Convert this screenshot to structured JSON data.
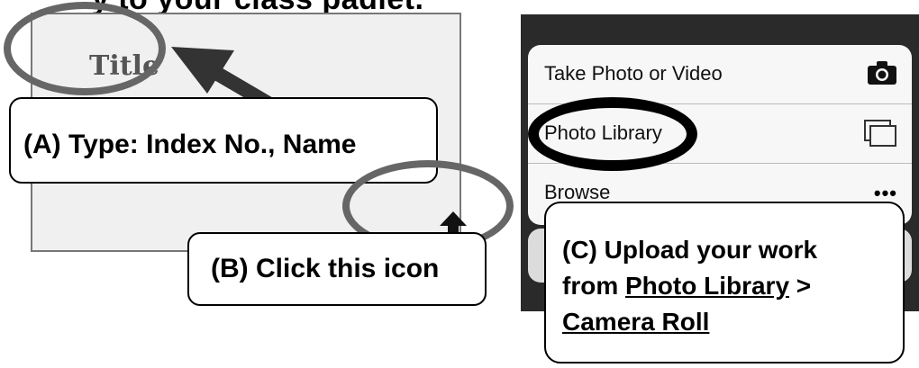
{
  "header": {
    "text": "...y to your class padlet."
  },
  "post": {
    "title": "Title",
    "upload_icon": "upload-arrow-icon"
  },
  "callouts": {
    "a": "(A) Type: Index No., Name",
    "b": "(B) Click this icon",
    "c": {
      "line1": "(C) Upload your work",
      "from": "from ",
      "photo_library": "Photo Library",
      "separator": " >",
      "camera_roll": "Camera Roll"
    }
  },
  "action_sheet": {
    "items": [
      {
        "label": "Take Photo or Video",
        "icon": "camera-icon"
      },
      {
        "label": "Photo Library",
        "icon": "photos-stack-icon"
      },
      {
        "label": "Browse",
        "icon": "more-dots-icon",
        "glyph": "•••"
      }
    ]
  },
  "colors": {
    "ring_gray": "#666666",
    "ring_black": "#000000",
    "panel_dark": "#2a2a2a"
  }
}
